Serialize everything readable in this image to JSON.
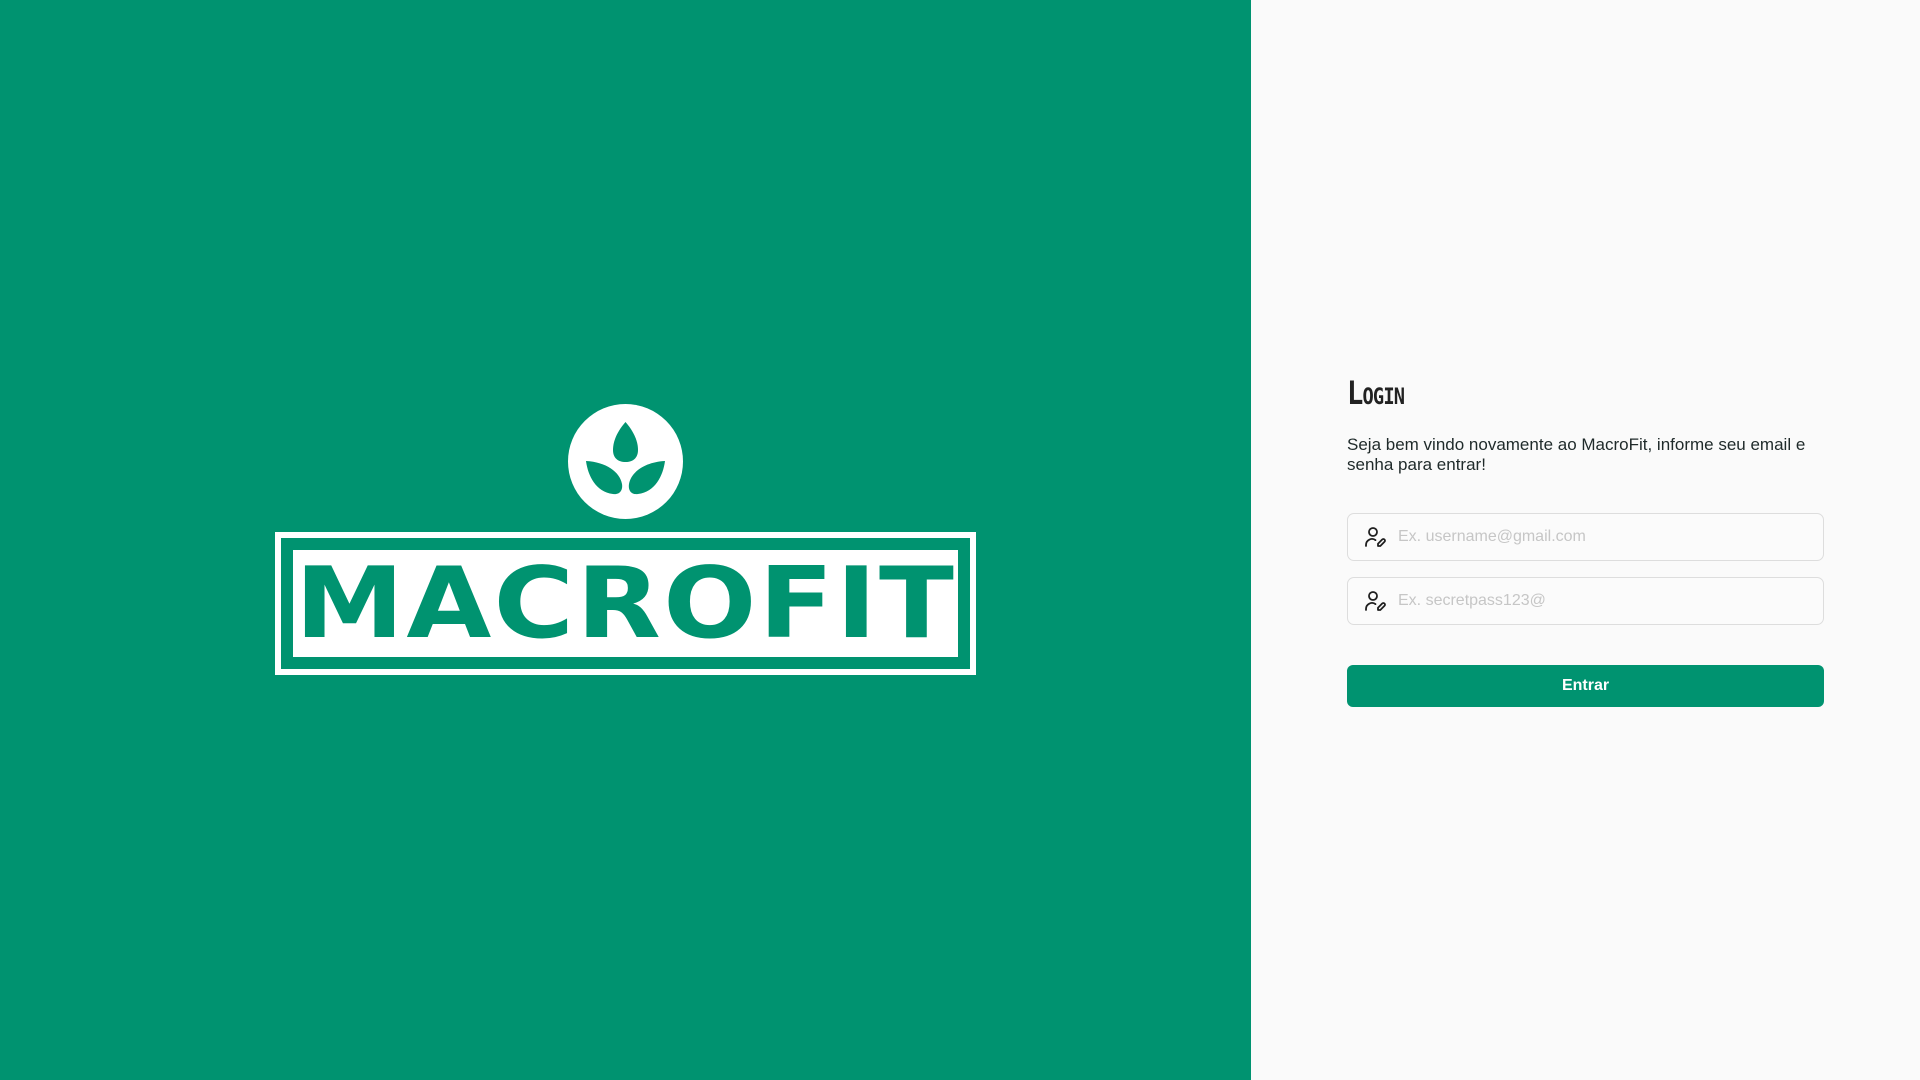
{
  "brand": {
    "logo_text": "MACROFIT",
    "logo_icon": "leaf-sprout-icon",
    "background_color": "#009370"
  },
  "login": {
    "title": "Login",
    "description": "Seja bem vindo novamente ao MacroFit, informe seu email e senha para entrar!",
    "email_field": {
      "icon": "user-pen-icon",
      "placeholder": "Ex. username@gmail.com",
      "value": ""
    },
    "password_field": {
      "icon": "user-pen-icon",
      "placeholder": "Ex. secretpass123@",
      "value": ""
    },
    "submit_label": "Entrar",
    "accent_color": "#009370"
  }
}
